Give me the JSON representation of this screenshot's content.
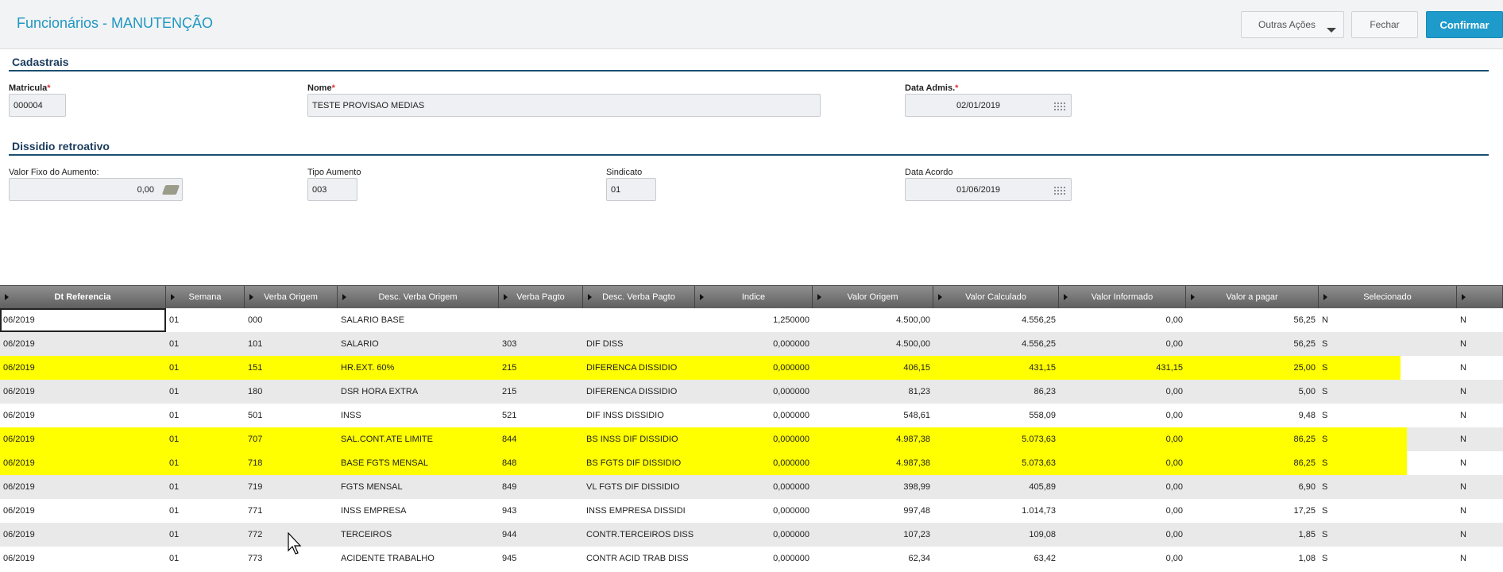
{
  "header": {
    "title": "Funcionários - MANUTENÇÃO",
    "outras_acoes": "Outras Ações",
    "fechar": "Fechar",
    "confirmar": "Confirmar"
  },
  "cadastrais": {
    "title": "Cadastrais",
    "matricula_label": "Matricula",
    "matricula_value": "000004",
    "nome_label": "Nome",
    "nome_value": "TESTE PROVISAO MEDIAS",
    "data_admis_label": "Data Admis.",
    "data_admis_value": "02/01/2019",
    "required_mark": "*"
  },
  "dissidio": {
    "title": "Dissidio retroativo",
    "valor_fixo_label": "Valor Fixo do Aumento:",
    "valor_fixo_value": "0,00",
    "tipo_aumento_label": "Tipo Aumento",
    "tipo_aumento_value": "003",
    "sindicato_label": "Sindicato",
    "sindicato_value": "01",
    "data_acordo_label": "Data Acordo",
    "data_acordo_value": "01/06/2019"
  },
  "grid": {
    "columns": [
      "Dt Referencia",
      "Semana",
      "Verba Origem",
      "Desc. Verba Origem",
      "Verba Pagto",
      "Desc. Verba Pagto",
      "Indice",
      "Valor Origem",
      "Valor Calculado",
      "Valor Informado",
      "Valor a pagar",
      "Selecionado",
      ""
    ],
    "rows": [
      [
        "06/2019",
        "01",
        "000",
        "SALARIO BASE",
        "",
        "",
        "1,250000",
        "4.500,00",
        "4.556,25",
        "0,00",
        "56,25",
        "N",
        "N"
      ],
      [
        "06/2019",
        "01",
        "101",
        "SALARIO",
        "303",
        "DIF DISS",
        "0,000000",
        "4.500,00",
        "4.556,25",
        "0,00",
        "56,25",
        "S",
        "N"
      ],
      [
        "06/2019",
        "01",
        "151",
        "HR.EXT.  60%",
        "215",
        "DIFERENCA DISSIDIO",
        "0,000000",
        "406,15",
        "431,15",
        "431,15",
        "25,00",
        "S",
        "N"
      ],
      [
        "06/2019",
        "01",
        "180",
        "DSR HORA EXTRA",
        "215",
        "DIFERENCA DISSIDIO",
        "0,000000",
        "81,23",
        "86,23",
        "0,00",
        "5,00",
        "S",
        "N"
      ],
      [
        "06/2019",
        "01",
        "501",
        "INSS",
        "521",
        "DIF INSS DISSIDIO",
        "0,000000",
        "548,61",
        "558,09",
        "0,00",
        "9,48",
        "S",
        "N"
      ],
      [
        "06/2019",
        "01",
        "707",
        "SAL.CONT.ATE LIMITE",
        "844",
        "BS INSS DIF DISSIDIO",
        "0,000000",
        "4.987,38",
        "5.073,63",
        "0,00",
        "86,25",
        "S",
        "N"
      ],
      [
        "06/2019",
        "01",
        "718",
        "BASE FGTS MENSAL",
        "848",
        "BS FGTS DIF DISSIDIO",
        "0,000000",
        "4.987,38",
        "5.073,63",
        "0,00",
        "86,25",
        "S",
        "N"
      ],
      [
        "06/2019",
        "01",
        "719",
        "FGTS MENSAL",
        "849",
        "VL FGTS DIF DISSIDIO",
        "0,000000",
        "398,99",
        "405,89",
        "0,00",
        "6,90",
        "S",
        "N"
      ],
      [
        "06/2019",
        "01",
        "771",
        "INSS EMPRESA",
        "943",
        "INSS EMPRESA DISSIDI",
        "0,000000",
        "997,48",
        "1.014,73",
        "0,00",
        "17,25",
        "S",
        "N"
      ],
      [
        "06/2019",
        "01",
        "772",
        "TERCEIROS",
        "944",
        "CONTR.TERCEIROS DISS",
        "0,000000",
        "107,23",
        "109,08",
        "0,00",
        "1,85",
        "S",
        "N"
      ],
      [
        "06/2019",
        "01",
        "773",
        "ACIDENTE TRABALHO",
        "945",
        "CONTR ACID TRAB DISS",
        "0,000000",
        "62,34",
        "63,42",
        "0,00",
        "1,08",
        "S",
        "N"
      ]
    ],
    "highlighted_rows": [
      2,
      5,
      6
    ],
    "highlight_color": "#ffff00"
  },
  "colors": {
    "accent": "#1e9bcb",
    "title": "#1f97c2",
    "section": "#1b3c5e"
  }
}
